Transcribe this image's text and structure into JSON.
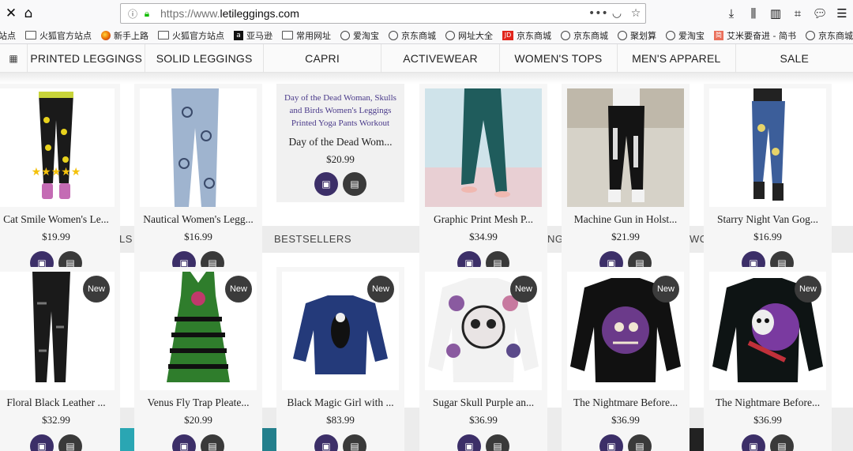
{
  "browser": {
    "url_prefix": "https://www.",
    "url_domain": "letileggings.com",
    "bookmarks": [
      {
        "icon": "globe-icon",
        "label": "站点"
      },
      {
        "icon": "folder-icon",
        "label": "火狐官方站点"
      },
      {
        "icon": "firefox-icon",
        "label": "新手上路"
      },
      {
        "icon": "folder-icon",
        "label": "火狐官方站点"
      },
      {
        "icon": "amazon-icon",
        "label": "亚马逊"
      },
      {
        "icon": "folder-icon",
        "label": "常用网址"
      },
      {
        "icon": "globe-icon",
        "label": "爱淘宝"
      },
      {
        "icon": "globe-icon",
        "label": "京东商城"
      },
      {
        "icon": "globe-icon",
        "label": "网址大全"
      },
      {
        "icon": "jd-icon",
        "label": "京东商城"
      },
      {
        "icon": "globe-icon",
        "label": "京东商城"
      },
      {
        "icon": "globe-icon",
        "label": "聚划算"
      },
      {
        "icon": "globe-icon",
        "label": "爱淘宝"
      },
      {
        "icon": "jianshu-icon",
        "label": "艾米要奋进 - 简书"
      },
      {
        "icon": "globe-icon",
        "label": "京东商城"
      }
    ]
  },
  "nav": {
    "items": [
      "PRINTED LEGGINGS",
      "SOLID LEGGINGS",
      "CAPRI",
      "ACTIVEWEAR",
      "WOMEN'S TOPS",
      "MEN'S APPAREL",
      "SALE"
    ]
  },
  "sections": {
    "bestsellers": "BESTSELLERS",
    "left_fragment": "LS",
    "mid_fragment": "NG",
    "right_fragment": "WO"
  },
  "row1": [
    {
      "title": "Cat Smile Women's Le...",
      "price": "$19.99"
    },
    {
      "title": "Nautical Women's Legg...",
      "price": "$16.99"
    },
    {
      "title": "Day of the Dead Wom...",
      "price": "$20.99",
      "description": "Day of the Dead Woman, Skulls and Birds Women's Leggings Printed Yoga Pants Workout"
    },
    {
      "title": "Graphic Print Mesh P...",
      "price": "$34.99"
    },
    {
      "title": "Machine Gun in Holst...",
      "price": "$21.99"
    },
    {
      "title": "Starry Night Van Gog...",
      "price": "$16.99"
    }
  ],
  "row2": [
    {
      "title": "Floral Black Leather ...",
      "price": "$32.99",
      "badge": "New"
    },
    {
      "title": "Venus Fly Trap Pleate...",
      "price": "$20.99",
      "badge": "New"
    },
    {
      "title": "Black Magic Girl with ...",
      "price": "$83.99",
      "badge": "New"
    },
    {
      "title": "Sugar Skull Purple an...",
      "price": "$36.99",
      "badge": "New"
    },
    {
      "title": "The Nightmare Before...",
      "price": "$36.99",
      "badge": "New"
    },
    {
      "title": "The Nightmare Before...",
      "price": "$36.99",
      "badge": "New"
    }
  ],
  "colors": {
    "accent": "#3c2f68",
    "dark_button": "#3a3a3a",
    "badge": "#3b3b3b"
  }
}
